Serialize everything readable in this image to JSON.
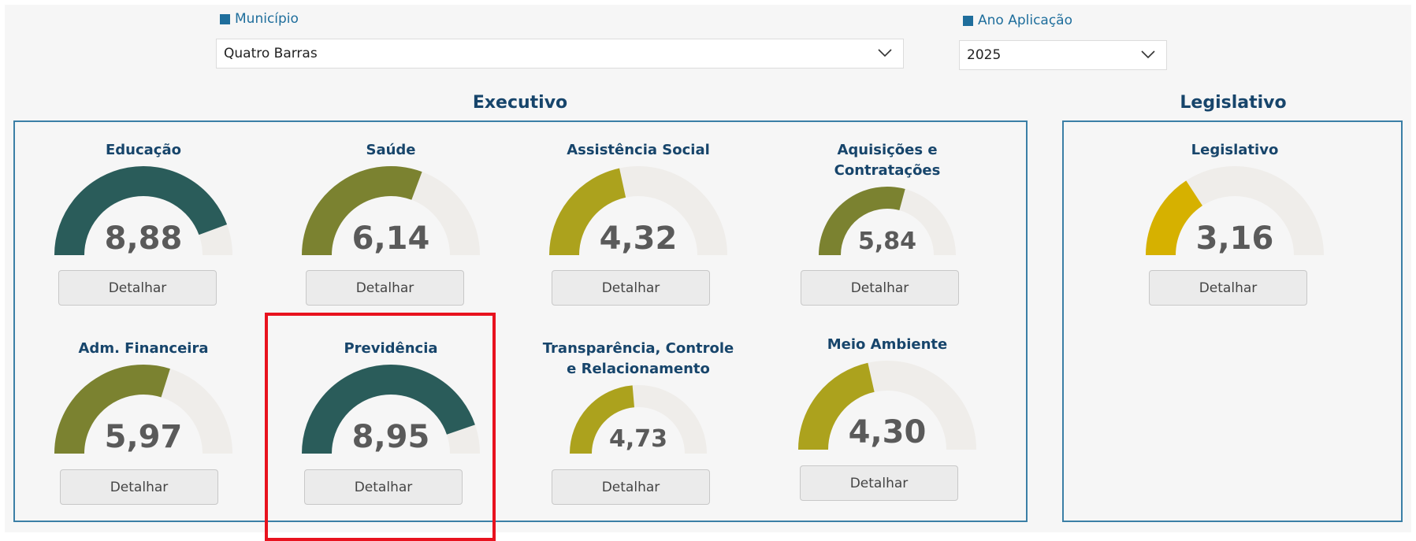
{
  "filters": {
    "municipio": {
      "label": "Município",
      "value": "Quatro Barras"
    },
    "ano": {
      "label": "Ano Aplicação",
      "value": "2025"
    }
  },
  "sections": {
    "executivo": "Executivo",
    "legislativo": "Legislativo"
  },
  "button_label": "Detalhar",
  "gauge_max": 10,
  "colors": {
    "dark_teal": "#2a5c5a",
    "olive": "#7b8230",
    "mustard": "#aca21d",
    "yellow": "#d6b100",
    "track": "#efedea",
    "highlight": "#e8121e"
  },
  "gauges": [
    {
      "title": "Educação",
      "value": "8,88",
      "score": 8.88,
      "color": "#2a5c5a"
    },
    {
      "title": "Saúde",
      "value": "6,14",
      "score": 6.14,
      "color": "#7b8230"
    },
    {
      "title": "Assistência Social",
      "value": "4,32",
      "score": 4.32,
      "color": "#aca21d"
    },
    {
      "title": "Aquisições e Contratações",
      "value": "5,84",
      "score": 5.84,
      "color": "#7b8230"
    },
    {
      "title": "Adm. Financeira",
      "value": "5,97",
      "score": 5.97,
      "color": "#7b8230"
    },
    {
      "title": "Previdência",
      "value": "8,95",
      "score": 8.95,
      "color": "#2a5c5a"
    },
    {
      "title": "Transparência, Controle e Relacionamento",
      "value": "4,73",
      "score": 4.73,
      "color": "#aca21d"
    },
    {
      "title": "Meio Ambiente",
      "value": "4,30",
      "score": 4.3,
      "color": "#aca21d"
    },
    {
      "title": "Legislativo",
      "value": "3,16",
      "score": 3.16,
      "color": "#d6b100"
    }
  ]
}
